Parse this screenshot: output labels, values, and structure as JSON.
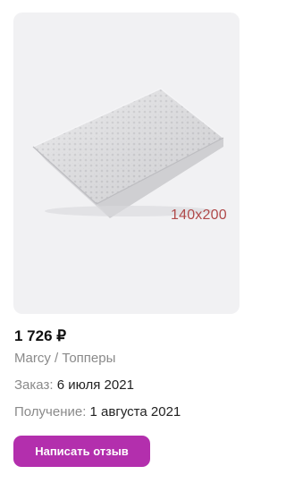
{
  "product": {
    "size_label": "140x200",
    "price": "1 726 ₽",
    "brand_category": "Marcy / Топперы"
  },
  "order": {
    "order_label": "Заказ:",
    "order_date": "6 июля 2021",
    "receive_label": "Получение:",
    "receive_date": "1 августа 2021"
  },
  "actions": {
    "review_button_label": "Написать отзыв"
  },
  "colors": {
    "accent": "#b32fad",
    "image_bg": "#f1f1f3",
    "size_label": "#b04a4a"
  }
}
